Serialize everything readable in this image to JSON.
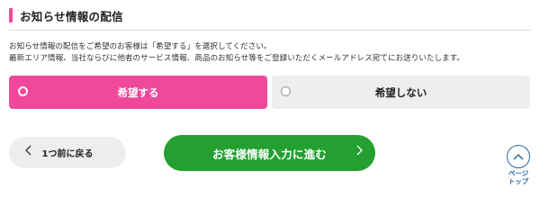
{
  "section": {
    "title": "お知らせ情報の配信"
  },
  "description": {
    "line1": "お知らせ情報の配信をご希望のお客様は「希望する」を選択してください。",
    "line2": "最新エリア情報、当社ならびに他者のサービス情報、商品のお知らせ等をご登録いただくメールアドレス宛てにお送りいたします。"
  },
  "options": [
    {
      "label": "希望する",
      "selected": true
    },
    {
      "label": "希望しない",
      "selected": false
    }
  ],
  "navigation": {
    "back_label": "1つ前に戻る",
    "next_label": "お客様情報入力に進む"
  },
  "page_top": {
    "line1": "ページ",
    "line2": "トップ"
  },
  "colors": {
    "accent": "#f0489b",
    "primary_button": "#23a02f",
    "page_top": "#2a6aa5"
  },
  "icons": {
    "back": "chevron-left-icon",
    "next": "chevron-right-icon",
    "page_top": "chevron-up-icon"
  }
}
